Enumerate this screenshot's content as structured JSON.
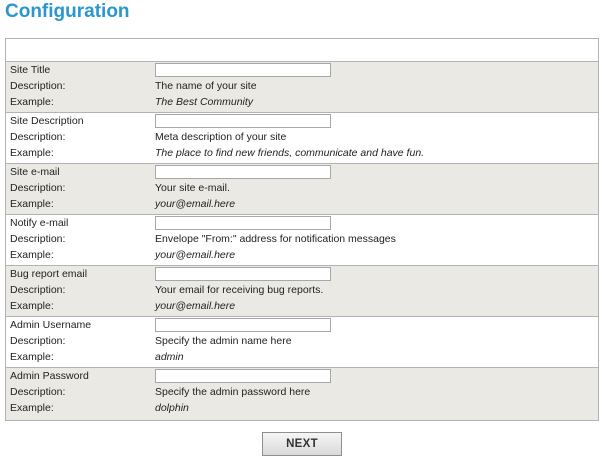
{
  "page": {
    "title": "Configuration"
  },
  "labels": {
    "description": "Description:",
    "example": "Example:"
  },
  "fields": [
    {
      "name": "Site Title",
      "value": "",
      "description": "The name of your site",
      "example": "The Best Community"
    },
    {
      "name": "Site Description",
      "value": "",
      "description": "Meta description of your site",
      "example": "The place to find new friends, communicate and have fun."
    },
    {
      "name": "Site e-mail",
      "value": "",
      "description": "Your site e-mail.",
      "example": "your@email.here"
    },
    {
      "name": "Notify e-mail",
      "value": "",
      "description": "Envelope \"From:\" address for notification messages",
      "example": "your@email.here"
    },
    {
      "name": "Bug report email",
      "value": "",
      "description": "Your email for receiving bug reports.",
      "example": "your@email.here"
    },
    {
      "name": "Admin Username",
      "value": "",
      "description": "Specify the admin name here",
      "example": "admin"
    },
    {
      "name": "Admin Password",
      "value": "",
      "description": "Specify the admin password here",
      "example": "dolphin"
    }
  ],
  "actions": {
    "next_label": "NEXT"
  },
  "colors": {
    "title": "#2b97cc",
    "shaded_row": "#ebe9e4",
    "border": "#b3b3b3"
  }
}
